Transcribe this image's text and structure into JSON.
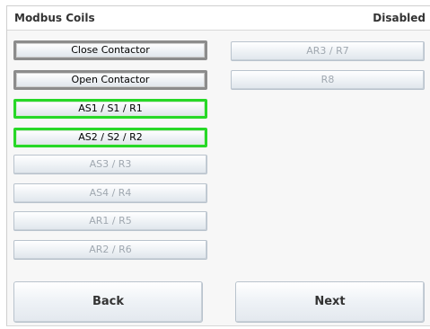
{
  "header": {
    "title": "Modbus Coils",
    "status": "Disabled"
  },
  "coils": {
    "close_contactor": "Close Contactor",
    "open_contactor": "Open Contactor",
    "as1": "AS1 / S1 / R1",
    "as2": "AS2 / S2 / R2",
    "as3": "AS3 / R3",
    "as4": "AS4 / R4",
    "ar1": "AR1 / R5",
    "ar2": "AR2 / R6",
    "ar3": "AR3 / R7",
    "r8": "R8"
  },
  "footer": {
    "back_label": "Back",
    "next_label": "Next"
  },
  "colors": {
    "active_green": "#27d827",
    "inactive_gray": "#8c8c8c",
    "disabled_text": "#a0a8b0"
  }
}
